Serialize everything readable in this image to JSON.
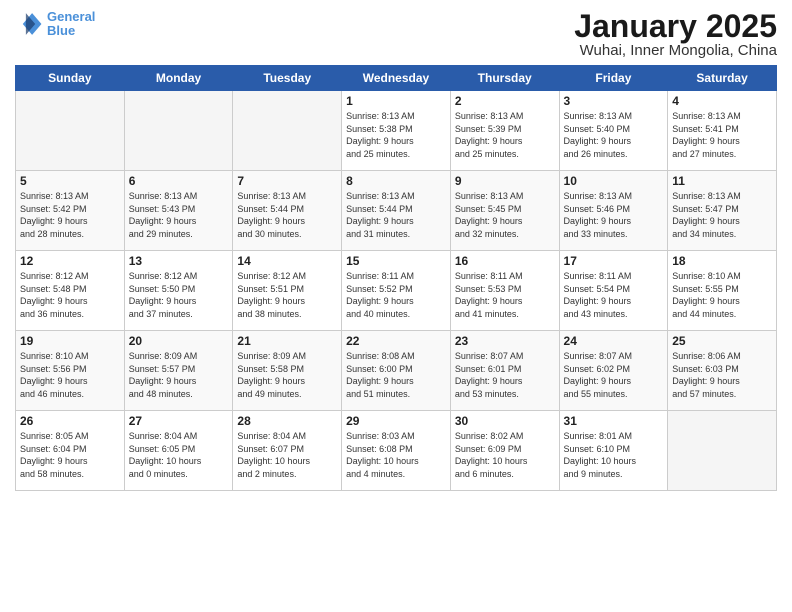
{
  "logo": {
    "line1": "General",
    "line2": "Blue"
  },
  "title": "January 2025",
  "subtitle": "Wuhai, Inner Mongolia, China",
  "days_header": [
    "Sunday",
    "Monday",
    "Tuesday",
    "Wednesday",
    "Thursday",
    "Friday",
    "Saturday"
  ],
  "weeks": [
    [
      {
        "day": "",
        "info": ""
      },
      {
        "day": "",
        "info": ""
      },
      {
        "day": "",
        "info": ""
      },
      {
        "day": "1",
        "info": "Sunrise: 8:13 AM\nSunset: 5:38 PM\nDaylight: 9 hours\nand 25 minutes."
      },
      {
        "day": "2",
        "info": "Sunrise: 8:13 AM\nSunset: 5:39 PM\nDaylight: 9 hours\nand 25 minutes."
      },
      {
        "day": "3",
        "info": "Sunrise: 8:13 AM\nSunset: 5:40 PM\nDaylight: 9 hours\nand 26 minutes."
      },
      {
        "day": "4",
        "info": "Sunrise: 8:13 AM\nSunset: 5:41 PM\nDaylight: 9 hours\nand 27 minutes."
      }
    ],
    [
      {
        "day": "5",
        "info": "Sunrise: 8:13 AM\nSunset: 5:42 PM\nDaylight: 9 hours\nand 28 minutes."
      },
      {
        "day": "6",
        "info": "Sunrise: 8:13 AM\nSunset: 5:43 PM\nDaylight: 9 hours\nand 29 minutes."
      },
      {
        "day": "7",
        "info": "Sunrise: 8:13 AM\nSunset: 5:44 PM\nDaylight: 9 hours\nand 30 minutes."
      },
      {
        "day": "8",
        "info": "Sunrise: 8:13 AM\nSunset: 5:44 PM\nDaylight: 9 hours\nand 31 minutes."
      },
      {
        "day": "9",
        "info": "Sunrise: 8:13 AM\nSunset: 5:45 PM\nDaylight: 9 hours\nand 32 minutes."
      },
      {
        "day": "10",
        "info": "Sunrise: 8:13 AM\nSunset: 5:46 PM\nDaylight: 9 hours\nand 33 minutes."
      },
      {
        "day": "11",
        "info": "Sunrise: 8:13 AM\nSunset: 5:47 PM\nDaylight: 9 hours\nand 34 minutes."
      }
    ],
    [
      {
        "day": "12",
        "info": "Sunrise: 8:12 AM\nSunset: 5:48 PM\nDaylight: 9 hours\nand 36 minutes."
      },
      {
        "day": "13",
        "info": "Sunrise: 8:12 AM\nSunset: 5:50 PM\nDaylight: 9 hours\nand 37 minutes."
      },
      {
        "day": "14",
        "info": "Sunrise: 8:12 AM\nSunset: 5:51 PM\nDaylight: 9 hours\nand 38 minutes."
      },
      {
        "day": "15",
        "info": "Sunrise: 8:11 AM\nSunset: 5:52 PM\nDaylight: 9 hours\nand 40 minutes."
      },
      {
        "day": "16",
        "info": "Sunrise: 8:11 AM\nSunset: 5:53 PM\nDaylight: 9 hours\nand 41 minutes."
      },
      {
        "day": "17",
        "info": "Sunrise: 8:11 AM\nSunset: 5:54 PM\nDaylight: 9 hours\nand 43 minutes."
      },
      {
        "day": "18",
        "info": "Sunrise: 8:10 AM\nSunset: 5:55 PM\nDaylight: 9 hours\nand 44 minutes."
      }
    ],
    [
      {
        "day": "19",
        "info": "Sunrise: 8:10 AM\nSunset: 5:56 PM\nDaylight: 9 hours\nand 46 minutes."
      },
      {
        "day": "20",
        "info": "Sunrise: 8:09 AM\nSunset: 5:57 PM\nDaylight: 9 hours\nand 48 minutes."
      },
      {
        "day": "21",
        "info": "Sunrise: 8:09 AM\nSunset: 5:58 PM\nDaylight: 9 hours\nand 49 minutes."
      },
      {
        "day": "22",
        "info": "Sunrise: 8:08 AM\nSunset: 6:00 PM\nDaylight: 9 hours\nand 51 minutes."
      },
      {
        "day": "23",
        "info": "Sunrise: 8:07 AM\nSunset: 6:01 PM\nDaylight: 9 hours\nand 53 minutes."
      },
      {
        "day": "24",
        "info": "Sunrise: 8:07 AM\nSunset: 6:02 PM\nDaylight: 9 hours\nand 55 minutes."
      },
      {
        "day": "25",
        "info": "Sunrise: 8:06 AM\nSunset: 6:03 PM\nDaylight: 9 hours\nand 57 minutes."
      }
    ],
    [
      {
        "day": "26",
        "info": "Sunrise: 8:05 AM\nSunset: 6:04 PM\nDaylight: 9 hours\nand 58 minutes."
      },
      {
        "day": "27",
        "info": "Sunrise: 8:04 AM\nSunset: 6:05 PM\nDaylight: 10 hours\nand 0 minutes."
      },
      {
        "day": "28",
        "info": "Sunrise: 8:04 AM\nSunset: 6:07 PM\nDaylight: 10 hours\nand 2 minutes."
      },
      {
        "day": "29",
        "info": "Sunrise: 8:03 AM\nSunset: 6:08 PM\nDaylight: 10 hours\nand 4 minutes."
      },
      {
        "day": "30",
        "info": "Sunrise: 8:02 AM\nSunset: 6:09 PM\nDaylight: 10 hours\nand 6 minutes."
      },
      {
        "day": "31",
        "info": "Sunrise: 8:01 AM\nSunset: 6:10 PM\nDaylight: 10 hours\nand 9 minutes."
      },
      {
        "day": "",
        "info": ""
      }
    ]
  ]
}
